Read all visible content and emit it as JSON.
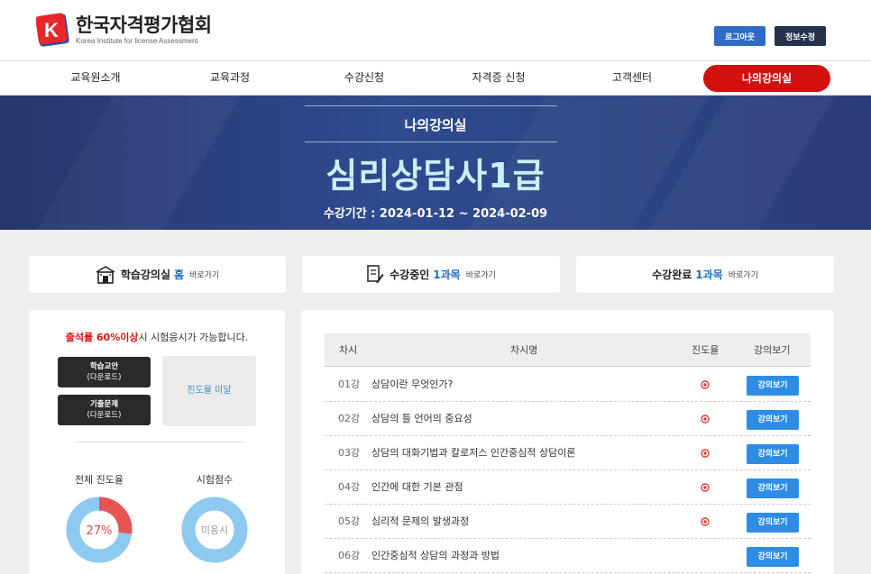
{
  "header": {
    "logo_letter": "K",
    "logo_title": "한국자격평가협회",
    "logo_sub": "Korea Institute for license Assessment",
    "logout_label": "로그아웃",
    "info_label": "정보수정"
  },
  "nav": {
    "items": [
      "교육원소개",
      "교육과정",
      "수강신청",
      "자격증 신청",
      "고객센터"
    ],
    "active": "나의강의실"
  },
  "banner": {
    "subtitle": "나의강의실",
    "title": "심리상담사1급",
    "period": "수강기간 : 2024-01-12 ~ 2024-02-09"
  },
  "quick": {
    "home": {
      "pre": "학습강의실",
      "hl": "홈",
      "go": "바로가기"
    },
    "ongoing": {
      "pre": "수강중인",
      "hl": "1과목",
      "go": "바로가기"
    },
    "done": {
      "pre": "수강완료",
      "hl": "1과목",
      "go": "바로가기"
    }
  },
  "left": {
    "notice_red": "출석률 60%이상",
    "notice_rest": "시 시험응시가 가능합니다.",
    "btn_study_line1": "학습교안",
    "btn_study_line2": "(다운로드)",
    "btn_exam_line1": "기출문제",
    "btn_exam_line2": "(다운로드)",
    "status": "진도율 미달",
    "total_progress_label": "전체 진도율",
    "total_progress_value": "27%",
    "total_progress_fraction": 0.27,
    "exam_score_label": "시험점수",
    "exam_score_value": "미응시"
  },
  "table": {
    "headers": {
      "no": "차시",
      "title": "차시명",
      "progress": "진도율",
      "watch": "강의보기"
    },
    "watch_label": "강의보기",
    "rows": [
      {
        "no": "01강",
        "title": "상담이란 무엇인가?",
        "progress_icon": true
      },
      {
        "no": "02강",
        "title": "상담의 틀 언어의 중요성",
        "progress_icon": true
      },
      {
        "no": "03강",
        "title": "상담의 대화기법과 칼로저스 인간중심적 상담이론",
        "progress_icon": true
      },
      {
        "no": "04강",
        "title": "인간에 대한 기본 관점",
        "progress_icon": true
      },
      {
        "no": "05강",
        "title": "심리적 문제의 발생과정",
        "progress_icon": true
      },
      {
        "no": "06강",
        "title": "인간중심적 상담의 과정과 방법",
        "progress_icon": false
      }
    ]
  },
  "colors": {
    "accent_red": "#d40f0f",
    "banner_blue": "#2f4a8f",
    "link_blue": "#1b6fc1",
    "button_blue": "#2d8ce4"
  }
}
